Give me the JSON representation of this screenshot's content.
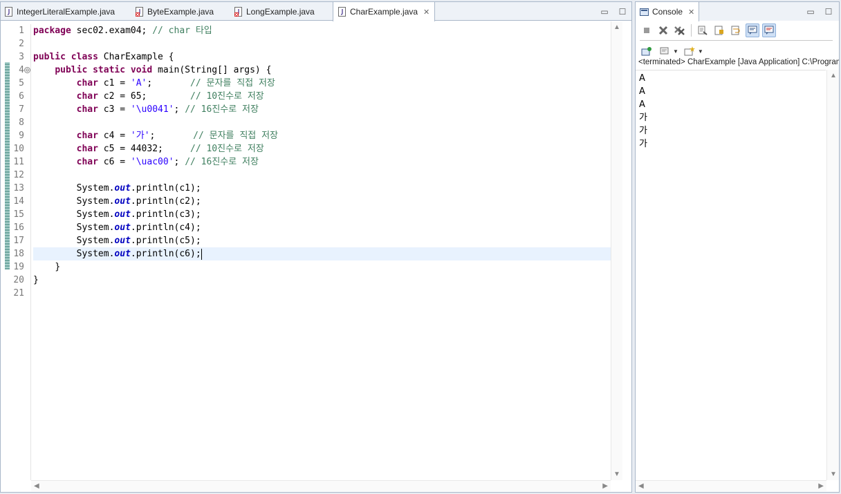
{
  "editor": {
    "tabs": [
      {
        "label": "IntegerLiteralExample.java",
        "icon": "java-file-icon"
      },
      {
        "label": "ByteExample.java",
        "icon": "java-file-error-icon"
      },
      {
        "label": "LongExample.java",
        "icon": "java-file-error-icon"
      },
      {
        "label": "CharExample.java",
        "icon": "java-file-icon",
        "active": true,
        "close": "✕"
      }
    ],
    "minimize": "▭",
    "maximize": "☐",
    "line_numbers": [
      "1",
      "2",
      "3",
      "4",
      "5",
      "6",
      "7",
      "8",
      "9",
      "10",
      "11",
      "12",
      "13",
      "14",
      "15",
      "16",
      "17",
      "18",
      "19",
      "20",
      "21"
    ],
    "fold_marker": "⊖",
    "code": {
      "l1_kw": "package",
      "l1_rest": " sec02.exam04; ",
      "l1_cm": "// char 타입",
      "l3_kw1": "public",
      "l3_kw2": "class",
      "l3_rest": " CharExample {",
      "l4_kw1": "public",
      "l4_kw2": "static",
      "l4_kw3": "void",
      "l4_rest": " main(String[] args) {",
      "char_kw": "char",
      "l5_decl": " c1 = ",
      "l5_val": "'A'",
      "l5_pad": ";       ",
      "l5_cm": "// 문자를 직접 저장",
      "l6_decl": " c2 = 65;        ",
      "l6_cm": "// 10진수로 저장",
      "l7_decl": " c3 = ",
      "l7_val": "'\\u0041'",
      "l7_pad": "; ",
      "l7_cm": "// 16진수로 저장",
      "l9_decl": " c4 = ",
      "l9_val": "'가'",
      "l9_pad": ";       ",
      "l9_cm": "// 문자를 직접 저장",
      "l10_decl": " c5 = 44032;     ",
      "l10_cm": "// 10진수로 저장",
      "l11_decl": " c6 = ",
      "l11_val": "'\\uac00'",
      "l11_pad": "; ",
      "l11_cm": "// 16진수로 저장",
      "sys": "System.",
      "out": "out",
      "p1": ".println(c1);",
      "p2": ".println(c2);",
      "p3": ".println(c3);",
      "p4": ".println(c4);",
      "p5": ".println(c5);",
      "p6": ".println(c6);",
      "close_method": "}",
      "close_class": "}"
    }
  },
  "console": {
    "tab_label": "Console",
    "close": "✕",
    "minimize": "▭",
    "maximize": "☐",
    "status": "<terminated> CharExample [Java Application] C:\\Program Files\\Java",
    "output": [
      "A",
      "A",
      "A",
      "가",
      "가",
      "가"
    ]
  }
}
